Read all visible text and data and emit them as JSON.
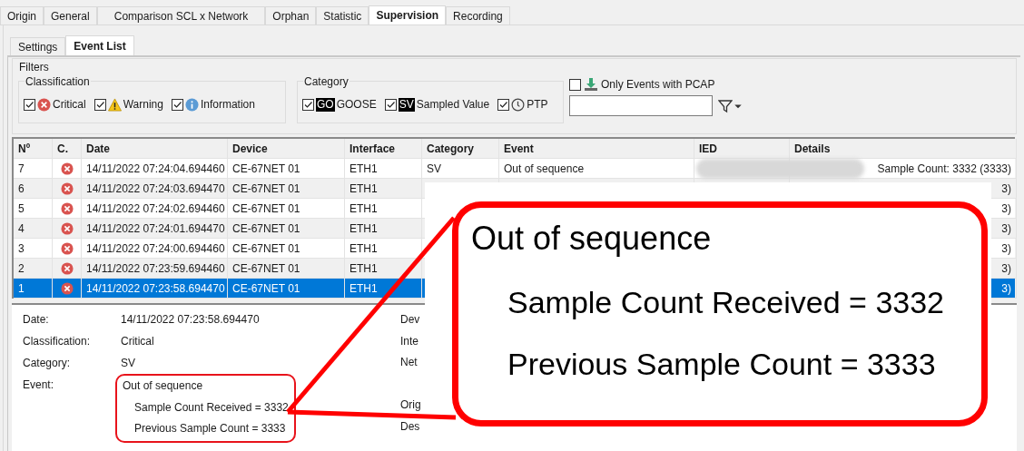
{
  "tabs": [
    {
      "label": "Origin",
      "selected": false
    },
    {
      "label": "General",
      "selected": false
    },
    {
      "label": "Comparison SCL x Network",
      "selected": false
    },
    {
      "label": "Orphan",
      "selected": false
    },
    {
      "label": "Statistic",
      "selected": false
    },
    {
      "label": "Supervision",
      "selected": true
    },
    {
      "label": "Recording",
      "selected": false
    }
  ],
  "subtabs": [
    {
      "label": "Settings",
      "selected": false
    },
    {
      "label": "Event List",
      "selected": true
    }
  ],
  "filters": {
    "title": "Filters",
    "classification": {
      "title": "Classification",
      "items": [
        {
          "kind": "critical",
          "label": "Critical",
          "checked": true
        },
        {
          "kind": "warning",
          "label": "Warning",
          "checked": true
        },
        {
          "kind": "information",
          "label": "Information",
          "checked": true
        }
      ]
    },
    "category": {
      "title": "Category",
      "items": [
        {
          "kind": "badge",
          "badge": "GO",
          "label": "GOOSE",
          "checked": true
        },
        {
          "kind": "badge",
          "badge": "SV",
          "label": "Sampled Value",
          "checked": true
        },
        {
          "kind": "clock",
          "label": "PTP",
          "checked": true
        }
      ]
    },
    "pcap": {
      "label": "Only Events with PCAP",
      "checked": false
    }
  },
  "table": {
    "columns": [
      "Nº",
      "C.",
      "Date",
      "Device",
      "Interface",
      "Category",
      "Event",
      "IED",
      "Details"
    ],
    "rows": [
      {
        "no": "7",
        "kind": "critical",
        "date": "14/11/2022 07:24:04.694460",
        "device": "CE-67NET 01",
        "interface": "ETH1",
        "category": "SV",
        "event": "Out of sequence",
        "details": "Sample Count: 3332 (3333)",
        "selected": false
      },
      {
        "no": "6",
        "kind": "critical",
        "date": "14/11/2022 07:24:03.694470",
        "device": "CE-67NET 01",
        "interface": "ETH1",
        "details": "3)",
        "selected": false
      },
      {
        "no": "5",
        "kind": "critical",
        "date": "14/11/2022 07:24:02.694460",
        "device": "CE-67NET 01",
        "interface": "ETH1",
        "details": "3)",
        "selected": false
      },
      {
        "no": "4",
        "kind": "critical",
        "date": "14/11/2022 07:24:01.694470",
        "device": "CE-67NET 01",
        "interface": "ETH1",
        "details": "3)",
        "selected": false
      },
      {
        "no": "3",
        "kind": "critical",
        "date": "14/11/2022 07:24:00.694460",
        "device": "CE-67NET 01",
        "interface": "ETH1",
        "details": "3)",
        "selected": false
      },
      {
        "no": "2",
        "kind": "critical",
        "date": "14/11/2022 07:23:59.694460",
        "device": "CE-67NET 01",
        "interface": "ETH1",
        "details": "3)",
        "selected": false
      },
      {
        "no": "1",
        "kind": "critical",
        "date": "14/11/2022 07:23:58.694470",
        "device": "CE-67NET 01",
        "interface": "ETH1",
        "details": "3)",
        "selected": true
      }
    ]
  },
  "details": {
    "fields": [
      {
        "label": "Date:",
        "value": "14/11/2022 07:23:58.694470"
      },
      {
        "label": "Classification:",
        "value": "Critical"
      },
      {
        "label": "Category:",
        "value": "SV"
      },
      {
        "label": "Event:",
        "value": "Out of sequence",
        "lines": [
          "Sample Count Received = 3332",
          "Previous Sample Count = 3333"
        ]
      }
    ],
    "right_labels": [
      "Dev",
      "Inte",
      "Net",
      "Orig",
      "Des"
    ]
  },
  "callout": {
    "title": "Out of sequence",
    "lines": [
      "Sample Count Received = 3332",
      "Previous Sample Count = 3333"
    ]
  }
}
